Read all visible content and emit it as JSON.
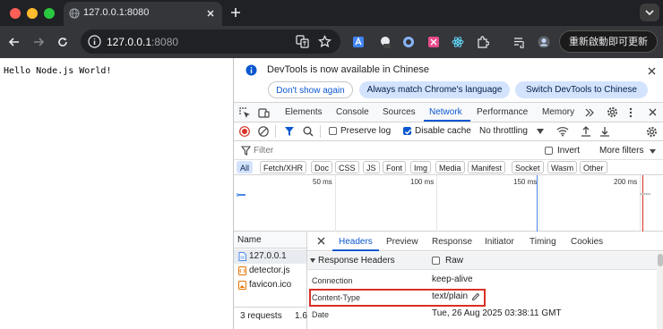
{
  "browser": {
    "tab": {
      "title": "127.0.0.1:8080"
    },
    "url": {
      "host": "127.0.0.1",
      "port": ":8080"
    },
    "update_button": "重新啟動即可更新",
    "colors": {
      "close": "#ff5f57",
      "minimize": "#febc2e",
      "maximize": "#28c840"
    }
  },
  "page": {
    "text": "Hello Node.js World!"
  },
  "devtools": {
    "infobar": {
      "message": "DevTools is now available in Chinese",
      "buttons": [
        "Don't show again",
        "Always match Chrome's language",
        "Switch DevTools to Chinese"
      ]
    },
    "panels": [
      "Elements",
      "Console",
      "Sources",
      "Network",
      "Performance",
      "Memory"
    ],
    "active_panel": "Network",
    "network_toolbar": {
      "preserve_log": "Preserve log",
      "disable_cache": "Disable cache",
      "disable_cache_checked": true,
      "throttling": "No throttling"
    },
    "filter": {
      "placeholder": "Filter",
      "invert": "Invert",
      "more_filters": "More filters"
    },
    "types": [
      "All",
      "Fetch/XHR",
      "Doc",
      "CSS",
      "JS",
      "Font",
      "Img",
      "Media",
      "Manifest",
      "Socket",
      "Wasm",
      "Other"
    ],
    "timeline_labels": [
      "50 ms",
      "100 ms",
      "150 ms",
      "200 ms"
    ],
    "requests": {
      "header": "Name",
      "items": [
        {
          "name": "127.0.0.1",
          "icon": "document-icon"
        },
        {
          "name": "detector.js",
          "icon": "script-icon"
        },
        {
          "name": "favicon.ico",
          "icon": "image-icon"
        }
      ],
      "summary": "3 requests",
      "summary_extra": "1.6"
    },
    "detail": {
      "tabs": [
        "Headers",
        "Preview",
        "Response",
        "Initiator",
        "Timing",
        "Cookies"
      ],
      "active_tab": "Headers",
      "section": "Response Headers",
      "raw_label": "Raw",
      "headers": [
        {
          "name": "Connection",
          "value": "keep-alive"
        },
        {
          "name": "Content-Type",
          "value": "text/plain"
        },
        {
          "name": "Date",
          "value": "Tue, 26 Aug 2025 03:38:11 GMT"
        }
      ],
      "highlight_color": "#d93025"
    }
  }
}
